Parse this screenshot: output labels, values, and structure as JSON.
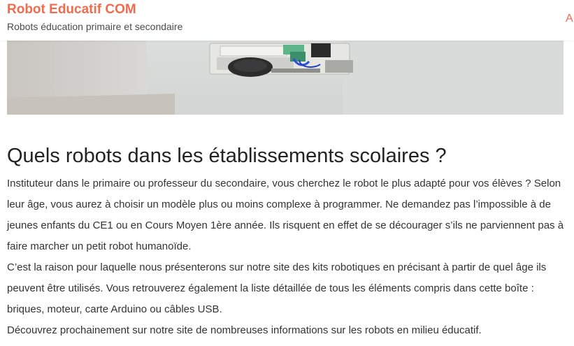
{
  "header": {
    "site_title": "Robot Educatif COM",
    "tagline": "Robots éducation primaire et secondaire",
    "menu_partial": "A"
  },
  "hero": {
    "icon": "robot-photo-image"
  },
  "article": {
    "title": "Quels robots dans les établissements scolaires ?",
    "paragraphs": [
      "Instituteur dans le primaire ou professeur du secondaire, vous cherchez le robot le plus adapté pour vos élèves ? Selon leur âge, vous aurez à choisir un modèle plus ou moins complexe à programmer. Ne demandez pas l’impossible à de jeunes enfants du CE1 ou en Cours Moyen 1ère année. Ils risquent en effet de se décourager s’ils ne parviennent pas à faire marcher un petit robot humanoïde.",
      "C’est la raison pour laquelle nous présenterons sur notre site des kits robotiques en précisant à partir de quel âge ils peuvent être utilisés. Vous retrouverez également la liste détaillée de tous les éléments compris dans cette boîte : briques, moteur, carte Arduino ou câbles USB.",
      "Découvrez prochainement sur notre site de nombreuses informations sur les robots en milieu éducatif."
    ]
  },
  "colors": {
    "accent": "#f26b4e",
    "text": "#333333",
    "heading": "#222222"
  }
}
